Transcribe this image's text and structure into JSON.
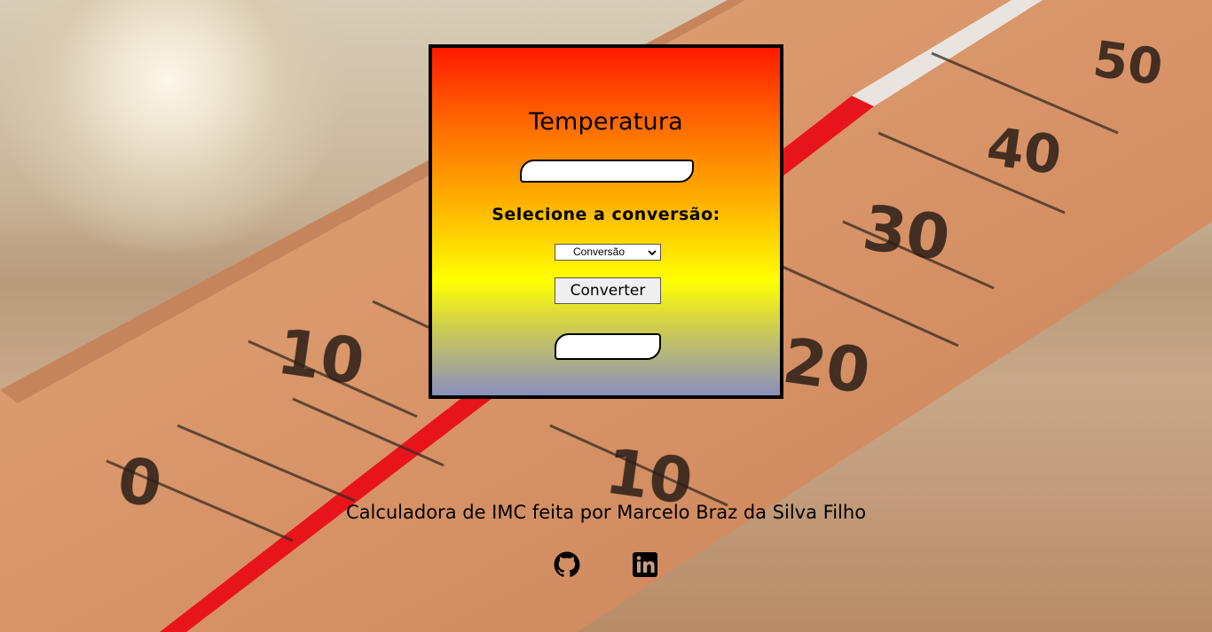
{
  "card": {
    "title": "Temperatura",
    "input_value": "",
    "select_label": "Selecione a conversão:",
    "select_selected": "Conversão",
    "convert_button": "Converter",
    "result_value": ""
  },
  "footer": {
    "credit": "Calculadora de IMC feita por Marcelo Braz da Silva Filho",
    "links": [
      {
        "icon": "github-icon"
      },
      {
        "icon": "linkedin-icon"
      }
    ]
  },
  "colors": {
    "card_top": "#ff1a00",
    "card_mid": "#ffff00",
    "card_bottom": "#8a8fbe",
    "border": "#000000"
  }
}
